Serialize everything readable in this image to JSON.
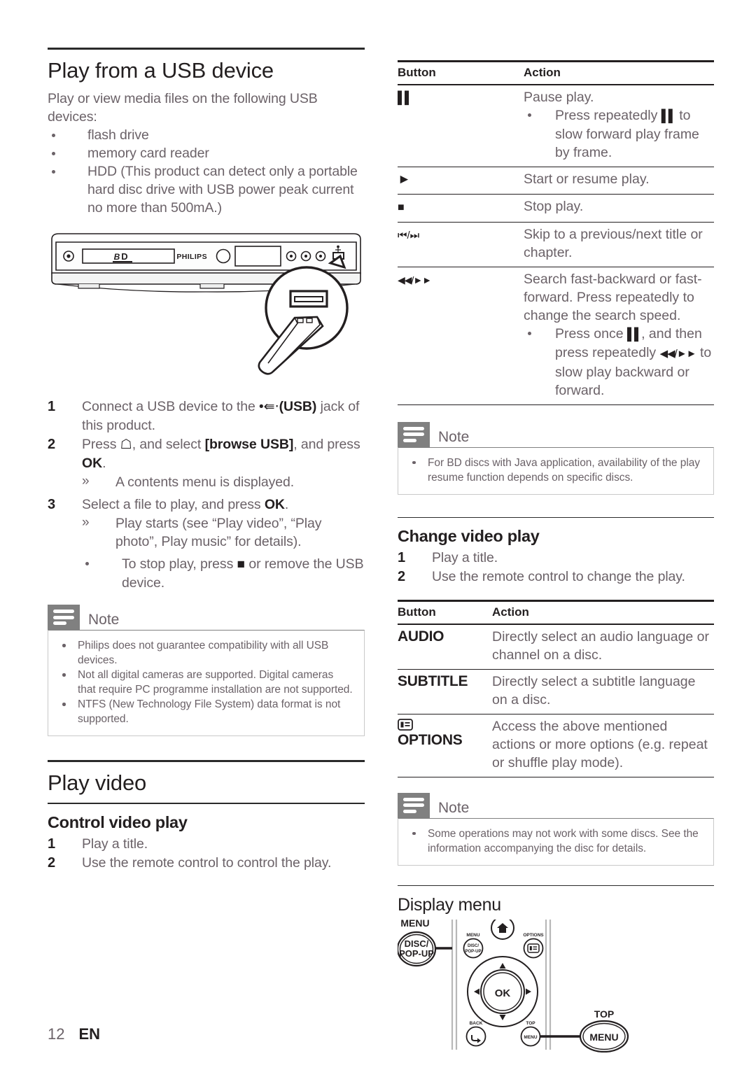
{
  "page": {
    "number": "12",
    "language": "EN"
  },
  "left": {
    "section_title": "Play from a USB device",
    "intro": "Play or view media files on the following USB devices:",
    "devices": [
      "flash drive",
      "memory card reader",
      "HDD (This product can detect only a portable hard disc drive with USB power peak current no more than 500mA.)"
    ],
    "figure": {
      "name": "usb-connection-diagram",
      "brand": "PHILIPS",
      "caption": ""
    },
    "steps": [
      {
        "num": "1",
        "text_before": "Connect a USB device to the ",
        "icon": "usb-icon",
        "bold": "(USB)",
        "text_after": " jack of this product.",
        "subs": []
      },
      {
        "num": "2",
        "text_before": "Press ",
        "icon": "home-icon",
        "text_mid": ", and select ",
        "bold": "[browse USB]",
        "text_after": ", and press ",
        "bold2": "OK",
        "text_end": ".",
        "subs": [
          {
            "mark": "arrow",
            "text": "A contents menu is displayed."
          }
        ]
      },
      {
        "num": "3",
        "text_before": "Select a file to play, and press ",
        "bold": "OK",
        "text_after": ".",
        "subs": [
          {
            "mark": "arrow",
            "text": "Play starts (see “Play video”, “Play photo”, Play music” for details)."
          },
          {
            "mark": "bullet",
            "text_a": "To stop play, press ",
            "icon": "stop-icon",
            "text_b": " or remove the USB device."
          }
        ]
      }
    ],
    "note": {
      "title": "Note",
      "items": [
        "Philips does not guarantee compatibility with all USB devices.",
        "Not all digital cameras are supported. Digital cameras that require PC programme installation are not supported.",
        "NTFS (New Technology File System) data format is not supported."
      ]
    },
    "play_video": {
      "section_title": "Play video",
      "subsection_title": "Control video play",
      "steps": [
        {
          "num": "1",
          "text": "Play a title."
        },
        {
          "num": "2",
          "text": "Use the remote control to control the play."
        }
      ]
    }
  },
  "right": {
    "table1": {
      "headers": {
        "button": "Button",
        "action": "Action"
      },
      "rows": [
        {
          "button_icon": "pause-icon",
          "button_glyph": "▐▌",
          "action": "Pause play.",
          "sub": {
            "text_a": "Press repeatedly ",
            "icon": "pause-icon",
            "text_b": " to slow forward play frame by frame."
          }
        },
        {
          "button_icon": "play-icon",
          "button_glyph": "▶",
          "action": "Start or resume play.",
          "sub": null
        },
        {
          "button_icon": "stop-icon",
          "button_glyph": "■",
          "action": "Stop play.",
          "sub": null
        },
        {
          "button_icon": "skip-previous-next-icon",
          "button_glyph": "⏮/⏭",
          "action": "Skip to a previous/next title or chapter.",
          "sub": null
        },
        {
          "button_icon": "fast-backward-forward-icon",
          "button_glyph": "◀◀/▶▶",
          "action": "Search fast-backward or fast-forward. Press repeatedly to change the search speed.",
          "sub": {
            "text_a": "Press once ",
            "icon": "pause-icon",
            "text_b": ", and then press repeatedly ",
            "icon2": "fast-backward-forward-icon",
            "text_c": " to slow play backward or forward."
          }
        }
      ]
    },
    "note1": {
      "title": "Note",
      "items": [
        "For BD discs with Java application, availability of the play resume function depends on specific discs."
      ]
    },
    "change_video_play": {
      "title": "Change video play",
      "steps": [
        {
          "num": "1",
          "text": "Play a title."
        },
        {
          "num": "2",
          "text": "Use the remote control to change the play."
        }
      ]
    },
    "table2": {
      "headers": {
        "button": "Button",
        "action": "Action"
      },
      "rows": [
        {
          "button_label": "AUDIO",
          "button_icon": null,
          "action": "Directly select an audio language or channel on a disc."
        },
        {
          "button_label": "SUBTITLE",
          "button_icon": null,
          "action": "Directly select a subtitle language on a disc."
        },
        {
          "button_label": "OPTIONS",
          "button_icon": "options-icon",
          "action": "Access the above mentioned actions or more options (e.g. repeat or shuffle play mode)."
        }
      ]
    },
    "note2": {
      "title": "Note",
      "items": [
        "Some operations may not work with some discs. See the information accompanying the disc for details."
      ]
    },
    "display_menu": {
      "title": "Display menu",
      "figure": {
        "name": "remote-control-menu-diagram",
        "callout_left_top": "MENU",
        "callout_left_line1": "DISC/",
        "callout_left_line2": "POP-UP",
        "callout_right_top": "TOP",
        "callout_right_label": "MENU",
        "remote_labels": {
          "menu_small": "MENU",
          "disc_popup_1": "DISC/",
          "disc_popup_2": "POP-UP",
          "options": "OPTIONS",
          "ok": "OK",
          "back": "BACK",
          "top": "TOP",
          "top_menu": "MENU"
        }
      }
    }
  }
}
